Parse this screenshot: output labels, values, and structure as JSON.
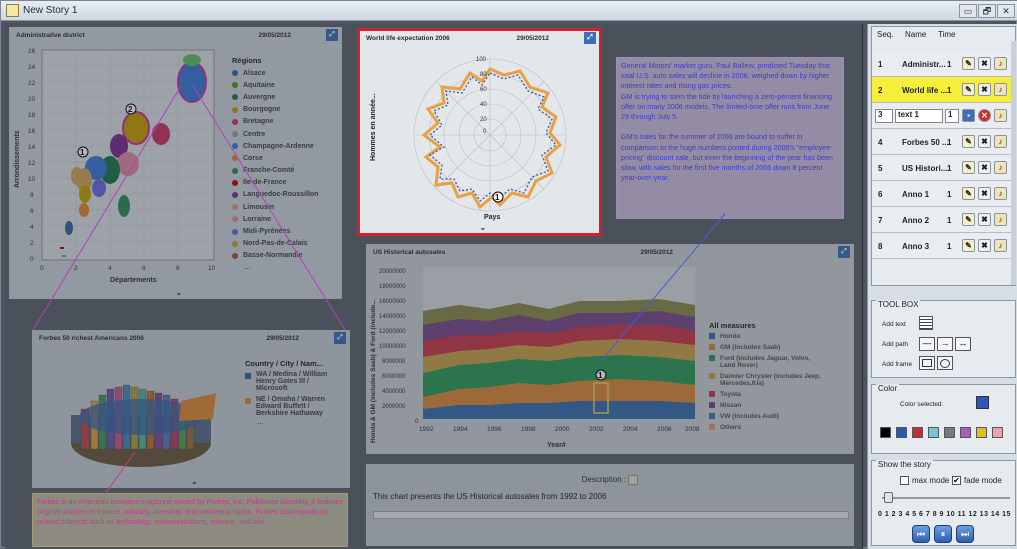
{
  "window": {
    "title": "New Story 1",
    "controls": [
      "▭",
      "🗗",
      "✕"
    ]
  },
  "p1": {
    "title": "Administrative district",
    "date": "29/05/2012",
    "y_axis": "Arrondissements",
    "x_axis": "Départements",
    "y_ticks": [
      "26",
      "24",
      "22",
      "20",
      "18",
      "16",
      "14",
      "12",
      "10",
      "8",
      "6",
      "4",
      "2",
      "0"
    ],
    "x_ticks": [
      "0",
      "2",
      "4",
      "6",
      "8",
      "10"
    ],
    "legend_title": "Régions",
    "legend": [
      {
        "label": "Alsace",
        "color": "#3465a4"
      },
      {
        "label": "Aquitaine",
        "color": "#4e9a06"
      },
      {
        "label": "Auvergne",
        "color": "#1a7a4a"
      },
      {
        "label": "Bourgogne",
        "color": "#c4a000"
      },
      {
        "label": "Bretagne",
        "color": "#cc3366"
      },
      {
        "label": "Centre",
        "color": "#a0a0a0"
      },
      {
        "label": "Champagne-Ardenne",
        "color": "#3a7ad8"
      },
      {
        "label": "Corse",
        "color": "#e08a2a"
      },
      {
        "label": "Franche-Comté",
        "color": "#2e8b57"
      },
      {
        "label": "Ile-de-France",
        "color": "#c00000"
      },
      {
        "label": "Languedoc-Roussillon",
        "color": "#7b2d8e"
      },
      {
        "label": "Limousin",
        "color": "#d4a55a"
      },
      {
        "label": "Lorraine",
        "color": "#e08aa0"
      },
      {
        "label": "Midi-Pyrénées",
        "color": "#6a6ae0"
      },
      {
        "label": "Nord-Pas-de-Calais",
        "color": "#b5a642"
      },
      {
        "label": "Basse-Normandie",
        "color": "#a0522d"
      }
    ],
    "more": "...",
    "callouts": [
      "1",
      "2"
    ]
  },
  "p2": {
    "title": "World life expectation 2006",
    "date": "29/05/2012",
    "y_axis": "Hommes en année...",
    "x_axis": "Pays",
    "r_ticks": [
      "100",
      "80",
      "60",
      "40",
      "20",
      "0"
    ],
    "callout": "1"
  },
  "p3": {
    "title": "Forbes 50 richest Americans 2006",
    "date": "29/05/2012",
    "legend_title": "Country / City / Nam...",
    "legend": [
      {
        "label": "WA / Medina / William Henry Gates III / Microsoft",
        "color": "#3b5fa0"
      },
      {
        "label": "NE / Omaha / Warren Edward Buffett / Berkshire Hathaway",
        "color": "#d88a3a"
      }
    ],
    "more": "..."
  },
  "p4": {
    "title": "US Historical autosales",
    "date": "29/05/2012",
    "y_axis": "Honda & GM (includes Saab) & Ford (include...",
    "x_axis": "Year#",
    "y_ticks": [
      "20000000",
      "18000000",
      "16000000",
      "14000000",
      "12000000",
      "10000000",
      "8000000",
      "6000000",
      "4000000",
      "2000000",
      "0"
    ],
    "x_ticks": [
      "1992",
      "1994",
      "1996",
      "1998",
      "2000",
      "2002",
      "2004",
      "2006",
      "2008"
    ],
    "legend_title": "All measures",
    "legend": [
      {
        "label": "Honda",
        "color": "#3b6fb0"
      },
      {
        "label": "GM (includes Saab)",
        "color": "#d98a3a"
      },
      {
        "label": "Ford (includes Jaguar, Volvo, Land Rover)",
        "color": "#2e9a5a"
      },
      {
        "label": "Daimler Chrysler (includes Jeep, Mercedes,Kia)",
        "color": "#c9a24a"
      },
      {
        "label": "Toyota",
        "color": "#c83a4a"
      },
      {
        "label": "Nissan",
        "color": "#7a4a8a"
      },
      {
        "label": "VW (includes Audi)",
        "color": "#4a7ab0"
      },
      {
        "label": "Others",
        "color": "#d4a070"
      }
    ],
    "callout": "1",
    "desc_label": "Description :",
    "desc_text": "This chart presents the US Historical autosales from 1992 to 2006"
  },
  "text_gm": "General Motors' market guru, Paul Ballew, predicted Tuesday that total U.S. auto sales will decline in 2006, weighed down by higher interest rates and rising gas prices.\nGM is trying to stem the tide by launching a zero-percent financing offer on many 2006 models. The limited-time offer runs from June 29 through July 5.\n\nGM's sales for the summer of 2006 are bound to suffer in comparison to the huge numbers posted during 2005's \"employee-pricing\" discount sale, but even the beginning of the year has been slow, with sales for the first five months of 2006 down 8 percent year-over-year.",
  "text_forbes": "Forbes is an American business magazine owned by Forbes, Inc. Published biweekly, it features original articles on finance, industry, investing, and marketing topics. Forbes also reports on related subjects such as technology, communications, science, and law.",
  "seq": {
    "headers": [
      "Seq.",
      "Name",
      "Time"
    ],
    "rows": [
      {
        "n": "1",
        "name": "Administr...",
        "time": "1"
      },
      {
        "n": "2",
        "name": "World life ...",
        "time": "1"
      },
      {
        "n": "3",
        "name": "text 1",
        "time": "1"
      },
      {
        "n": "4",
        "name": "Forbes 50 ...",
        "time": "1"
      },
      {
        "n": "5",
        "name": "US Histori...",
        "time": "1"
      },
      {
        "n": "6",
        "name": "Anno 1",
        "time": "1"
      },
      {
        "n": "7",
        "name": "Anno 2",
        "time": "1"
      },
      {
        "n": "8",
        "name": "Anno 3",
        "time": "1"
      }
    ]
  },
  "toolbox": {
    "title": "TOOL BOX",
    "add_text": "Add text",
    "add_path": "Add path",
    "add_frame": "Add frame"
  },
  "color": {
    "title": "Color",
    "selected_label": "Color selected:",
    "selected": "#2d56b8",
    "palette": [
      "#000000",
      "#2d56b8",
      "#c0303a",
      "#6fc8d8",
      "#7a7a7a",
      "#b05ab8",
      "#e0c020",
      "#f0a0a8"
    ]
  },
  "show": {
    "title": "Show the story",
    "max_mode": "max mode",
    "fade_mode": "fade mode",
    "scale": "0 1 2 3 4 5 6 7 8 9 10 11 12 13 14 15",
    "fade_checked": true,
    "max_checked": false
  }
}
